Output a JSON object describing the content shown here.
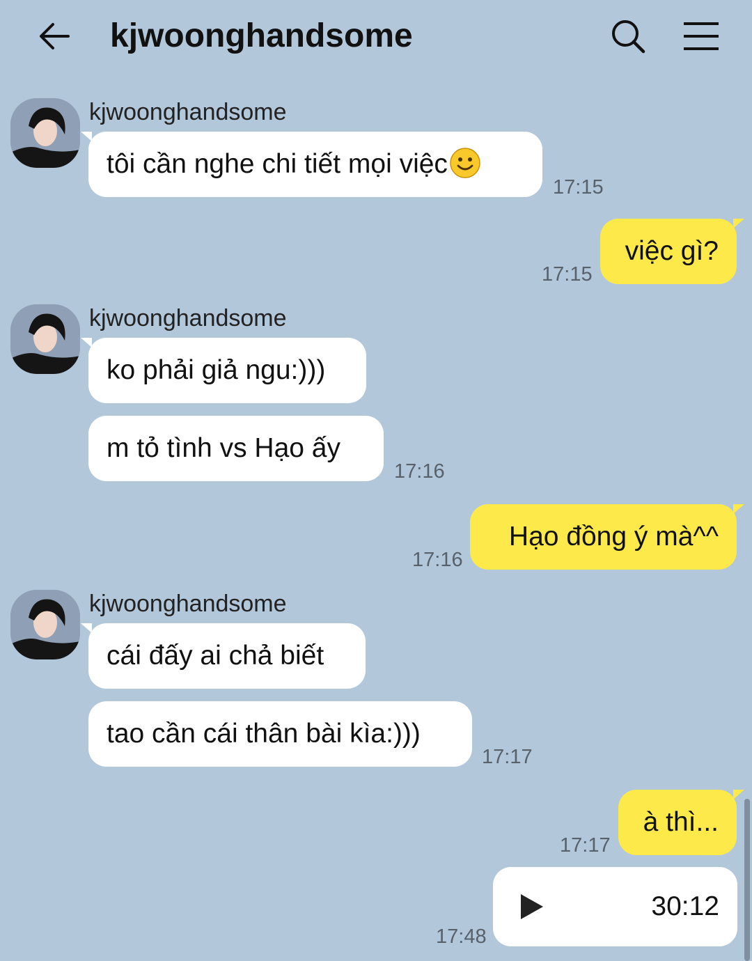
{
  "header": {
    "title": "kjwoonghandsome",
    "back_icon": "arrow-left-icon",
    "search_icon": "search-icon",
    "menu_icon": "hamburger-menu-icon"
  },
  "messages": [
    {
      "sender": "kjwoonghandsome",
      "text": "tôi cần nghe chi tiết mọi việc",
      "emoji": "smiley-face-icon",
      "time": "17:15"
    },
    {
      "text": "việc gì?",
      "time": "17:15"
    },
    {
      "sender": "kjwoonghandsome",
      "text": "ko phải giả ngu:)))"
    },
    {
      "text": "m tỏ tình vs Hạo ấy",
      "time": "17:16"
    },
    {
      "text": "Hạo đồng ý mà^^",
      "time": "17:16"
    },
    {
      "sender": "kjwoonghandsome",
      "text": "cái đấy ai chả biết"
    },
    {
      "text": "tao cần cái thân bài kìa:)))",
      "time": "17:17"
    },
    {
      "text": "à thì...",
      "time": "17:17"
    },
    {
      "audio_duration": "30:12",
      "play_icon": "play-icon",
      "time": "17:48"
    }
  ],
  "colors": {
    "background": "#b2c7da",
    "incoming_bubble": "#ffffff",
    "outgoing_bubble": "#fde94a"
  }
}
